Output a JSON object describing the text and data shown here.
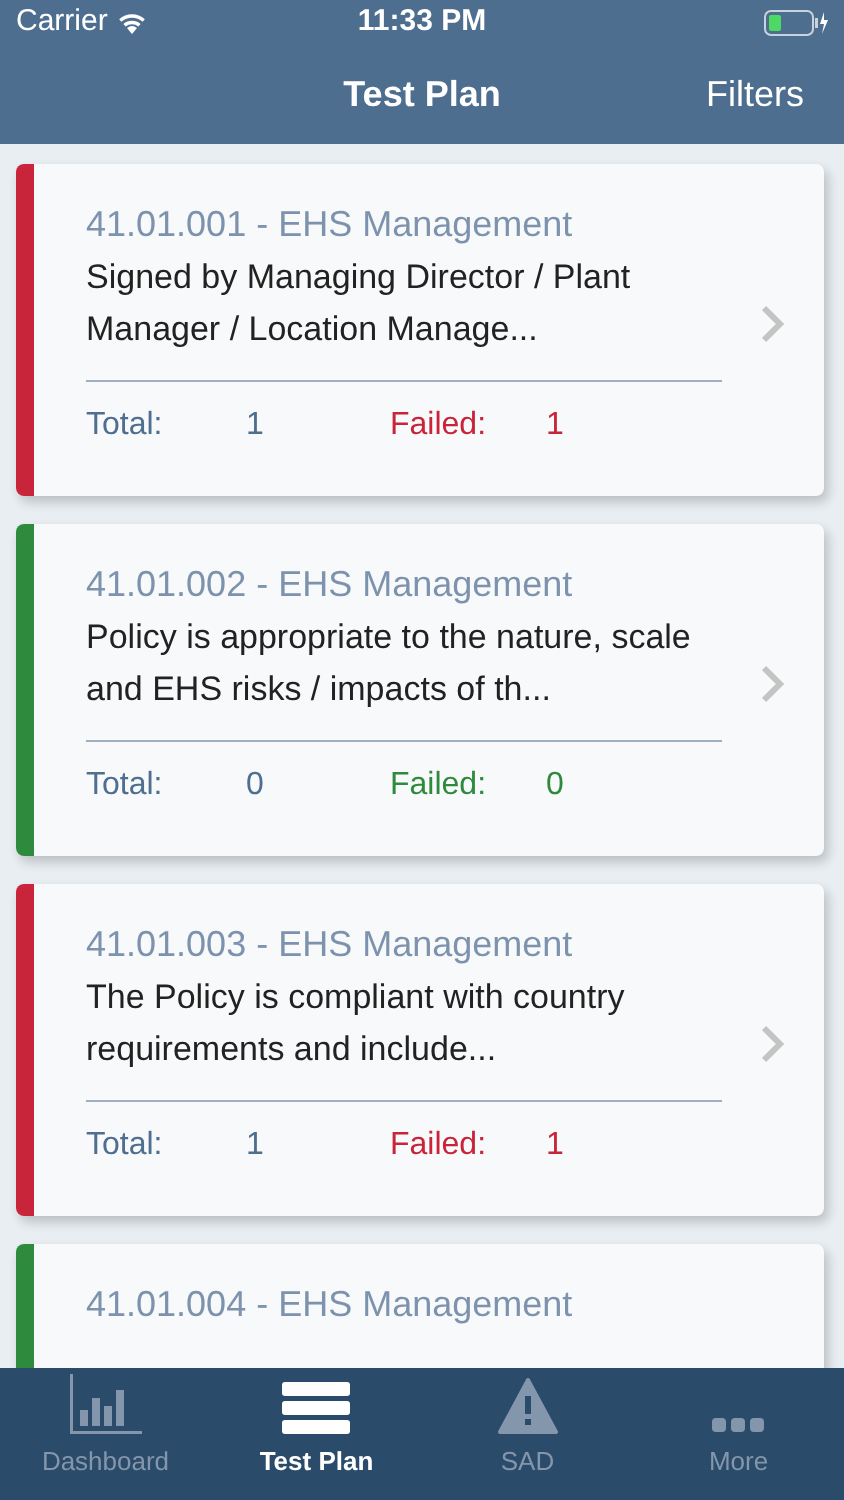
{
  "status_bar": {
    "carrier": "Carrier",
    "time": "11:33 PM"
  },
  "nav_bar": {
    "title": "Test Plan",
    "action": "Filters"
  },
  "cards": [
    {
      "code": "41.01.001 - EHS Management",
      "description": "Signed by Managing Director / Plant Manager / Location Manage...",
      "total_label": "Total:",
      "total": "1",
      "failed_label": "Failed:",
      "failed": "1",
      "color": "#c8243a"
    },
    {
      "code": "41.01.002 - EHS Management",
      "description": "Policy is appropriate to the nature, scale and EHS risks / impacts of th...",
      "total_label": "Total:",
      "total": "0",
      "failed_label": "Failed:",
      "failed": "0",
      "color": "#2e8b3e"
    },
    {
      "code": "41.01.003 - EHS Management",
      "description": "The Policy is compliant with country requirements and include...",
      "total_label": "Total:",
      "total": "1",
      "failed_label": "Failed:",
      "failed": "1",
      "color": "#c8243a"
    },
    {
      "code": "41.01.004 - EHS Management",
      "color": "#2e8b3e"
    }
  ],
  "tab_bar": [
    {
      "label": "Dashboard",
      "kind": "chart",
      "selected": false
    },
    {
      "label": "Test Plan",
      "kind": "list",
      "selected": true
    },
    {
      "label": "SAD",
      "kind": "warning",
      "selected": false
    },
    {
      "label": "More",
      "kind": "more",
      "selected": false
    }
  ]
}
